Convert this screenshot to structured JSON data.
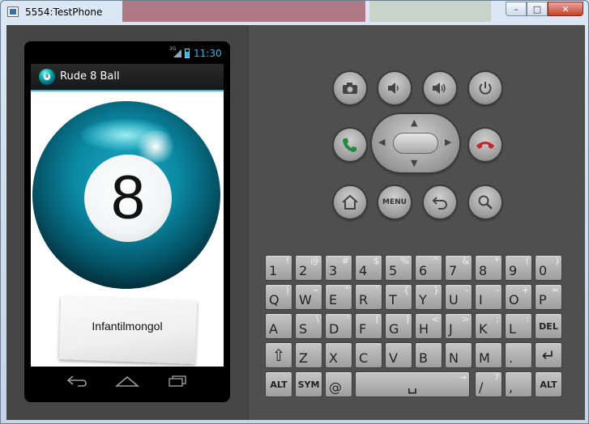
{
  "window": {
    "title": "5554:TestPhone",
    "minimize_glyph": "–",
    "maximize_glyph": "□",
    "close_glyph": "✕"
  },
  "status_bar": {
    "network": "3G",
    "time": "11:30",
    "accent_color": "#33b5e5"
  },
  "app": {
    "title": "Rude 8 Ball",
    "ball_number": "8",
    "answer": "Infantilmongol"
  },
  "nav_bar": {
    "back_icon": "back-icon",
    "home_icon": "home-icon",
    "recents_icon": "recents-icon"
  },
  "controls": {
    "menu_label": "MENU",
    "keys": [
      [
        "1",
        "!"
      ],
      [
        "2",
        "@"
      ],
      [
        "3",
        "#"
      ],
      [
        "4",
        "$"
      ],
      [
        "5",
        "%"
      ],
      [
        "6",
        "^"
      ],
      [
        "7",
        "&"
      ],
      [
        "8",
        "*"
      ],
      [
        "9",
        "("
      ],
      [
        "0",
        ")"
      ],
      [
        "Q",
        "|"
      ],
      [
        "W",
        "~"
      ],
      [
        "E",
        "\""
      ],
      [
        "R",
        "`"
      ],
      [
        "T",
        "{"
      ],
      [
        "Y",
        "}"
      ],
      [
        "U",
        "–"
      ],
      [
        "I",
        "-"
      ],
      [
        "O",
        "+"
      ],
      [
        "P",
        "="
      ],
      [
        "A",
        ""
      ],
      [
        "S",
        "\\"
      ],
      [
        "D",
        "'"
      ],
      [
        "F",
        "["
      ],
      [
        "G",
        "]"
      ],
      [
        "H",
        "<"
      ],
      [
        "J",
        ">"
      ],
      [
        "K",
        ";"
      ],
      [
        "L",
        ":"
      ],
      [
        "DEL",
        ""
      ],
      [
        "⇧",
        ""
      ],
      [
        "Z",
        ""
      ],
      [
        "X",
        ""
      ],
      [
        "C",
        ""
      ],
      [
        "V",
        ""
      ],
      [
        "B",
        ""
      ],
      [
        "N",
        ""
      ],
      [
        "M",
        ""
      ],
      [
        ".",
        ""
      ],
      [
        "↵",
        ""
      ],
      [
        "ALT",
        ""
      ],
      [
        "SYM",
        ""
      ],
      [
        "@",
        ""
      ],
      [
        "␣",
        "→"
      ],
      [
        "/",
        "?"
      ],
      [
        ",",
        ""
      ],
      [
        "ALT",
        ""
      ]
    ]
  }
}
